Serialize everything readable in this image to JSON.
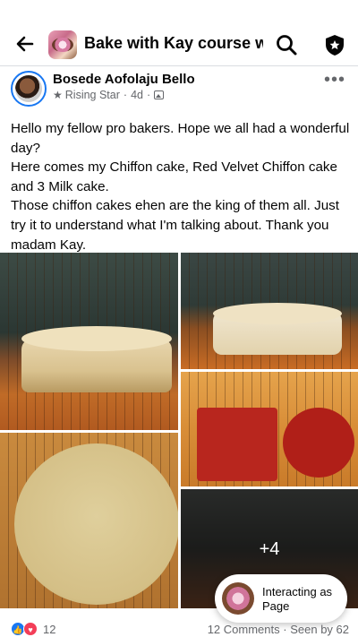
{
  "header": {
    "title": "Bake with Kay course wit...",
    "back_icon": "arrow-left-icon",
    "search_icon": "search-icon",
    "shield_icon": "shield-star-icon"
  },
  "post": {
    "author": "Bosede Aofolaju Bello",
    "badge": "Rising Star",
    "time": "4d",
    "separator": "·",
    "more": "•••",
    "lines": [
      "Hello my fellow pro bakers. Hope we all had a wonderful day?",
      "Here comes my Chiffon cake, Red Velvet Chiffon cake and 3 Milk cake.",
      "Those chiffon cakes ehen are the king of them all. Just try it to understand what I'm talking about. Thank you madam Kay."
    ]
  },
  "photos": {
    "more_count": "+4"
  },
  "interacting": {
    "label": "Interacting as Page"
  },
  "footer": {
    "reaction_count": "12",
    "comments": "12 Comments",
    "dot": "·",
    "seen": "Seen by 62"
  },
  "colors": {
    "accent": "#1877f2",
    "love": "#f33e58",
    "muted": "#65676b"
  }
}
